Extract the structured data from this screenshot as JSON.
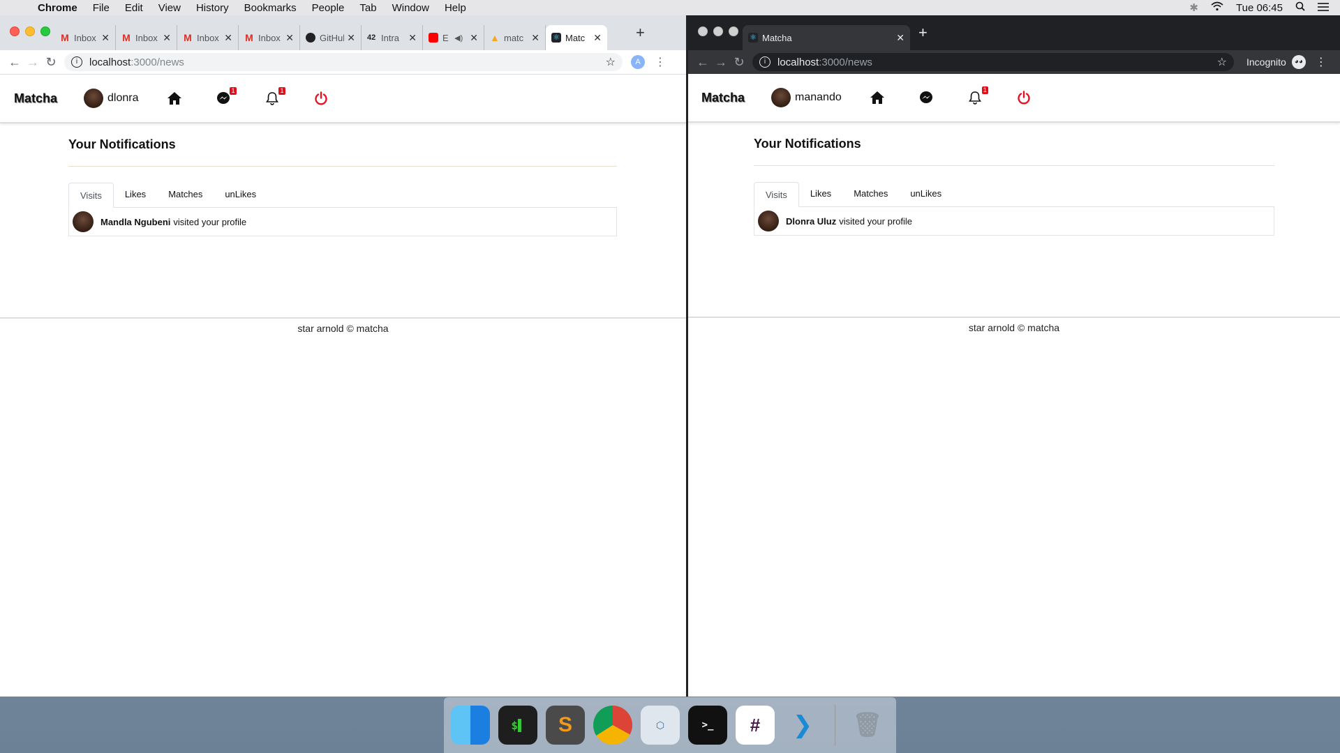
{
  "menubar": {
    "app_name": "Chrome",
    "items": [
      "File",
      "Edit",
      "View",
      "History",
      "Bookmarks",
      "People",
      "Tab",
      "Window",
      "Help"
    ],
    "clock": "Tue 06:45"
  },
  "left_window": {
    "tabs": [
      {
        "title": "Inbox",
        "icon": "gmail-icon"
      },
      {
        "title": "Inbox",
        "icon": "gmail-icon"
      },
      {
        "title": "Inbox",
        "icon": "gmail-icon"
      },
      {
        "title": "Inbox",
        "icon": "gmail-icon"
      },
      {
        "title": "GitHub",
        "icon": "github-icon"
      },
      {
        "title": "Intra",
        "icon": "intra-icon"
      },
      {
        "title": "E",
        "icon": "youtube-icon"
      },
      {
        "title": "matc",
        "icon": "firebase-icon"
      },
      {
        "title": "Matc",
        "icon": "react-icon",
        "active": true
      }
    ],
    "url_host": "localhost",
    "url_path": ":3000/news",
    "profile_initial": "A",
    "app": {
      "brand": "Matcha",
      "username": "dlonra",
      "messages_badge": "1",
      "notifications_badge": "1",
      "title": "Your Notifications",
      "tabs": [
        "Visits",
        "Likes",
        "Matches",
        "unLikes"
      ],
      "notification": {
        "name": "Mandla Ngubeni",
        "text": "visited your profile"
      },
      "footer": "star arnold © matcha"
    }
  },
  "right_window": {
    "tab_title": "Matcha",
    "url_host": "localhost",
    "url_path": ":3000/news",
    "incognito_label": "Incognito",
    "app": {
      "brand": "Matcha",
      "username": "manando",
      "notifications_badge": "1",
      "title": "Your Notifications",
      "tabs": [
        "Visits",
        "Likes",
        "Matches",
        "unLikes"
      ],
      "notification": {
        "name": "Dlonra Uluz",
        "text": "visited your profile"
      },
      "footer": "star arnold © matcha"
    }
  },
  "colors": {
    "accent_red": "#e0101b",
    "power_red": "#e81123"
  },
  "dock": [
    "finder-icon",
    "terminal-icon",
    "sublime-text-icon",
    "chrome-icon",
    "virtualbox-icon",
    "terminal-icon",
    "slack-icon",
    "vscode-icon",
    "trash-icon"
  ]
}
